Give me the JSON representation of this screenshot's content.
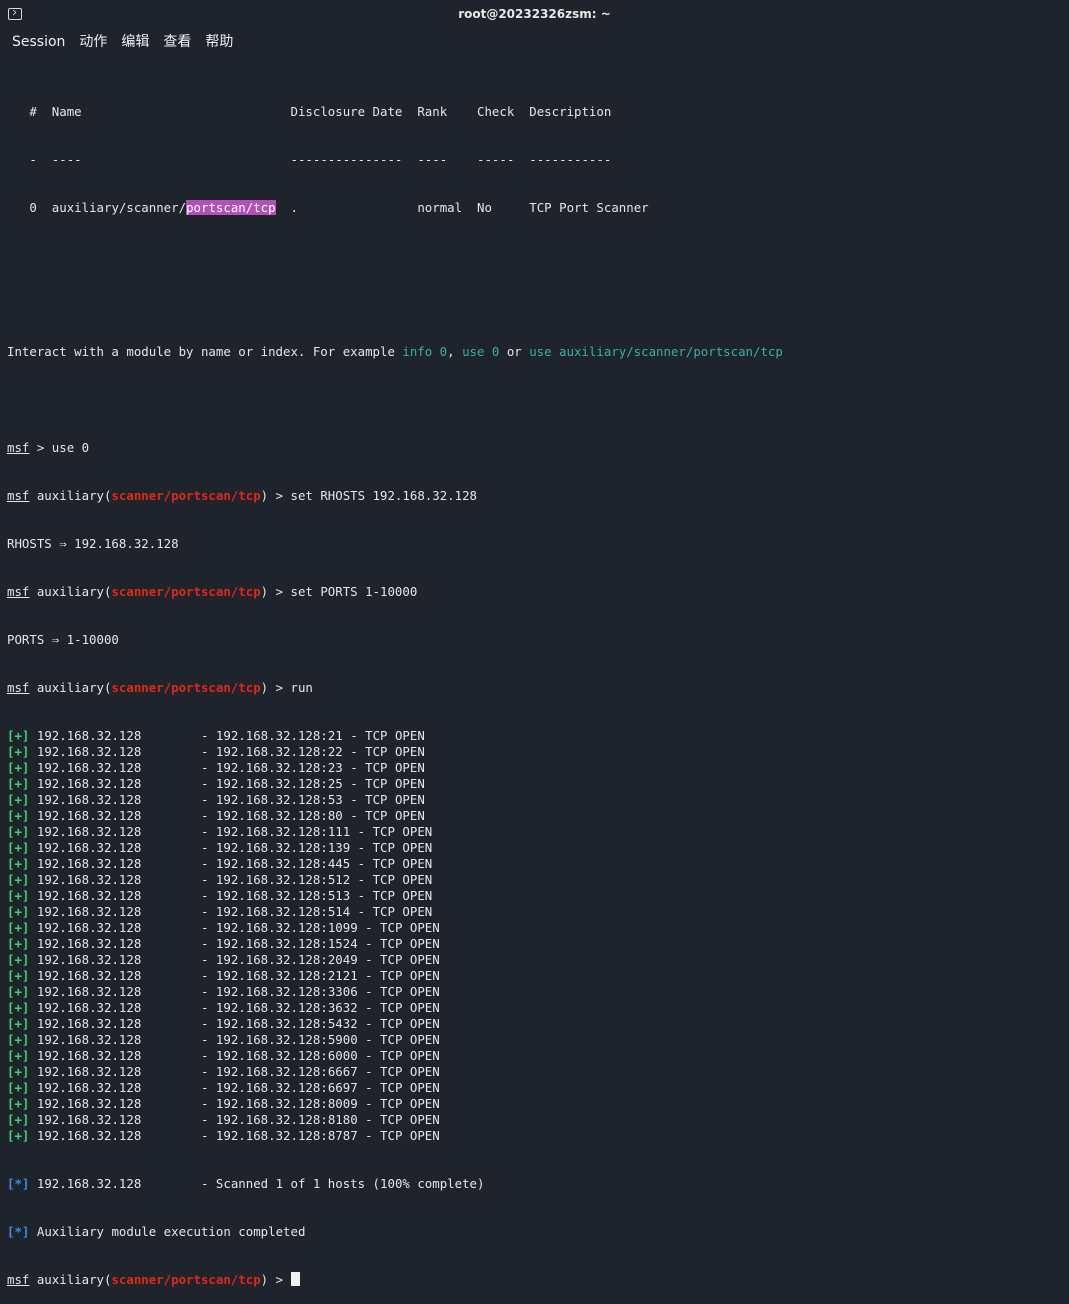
{
  "window": {
    "title": "root@20232326zsm: ~"
  },
  "menu": [
    "Session",
    "动作",
    "编辑",
    "查看",
    "帮助"
  ],
  "table": {
    "headers": [
      "#",
      "Name",
      "Disclosure Date",
      "Rank",
      "Check",
      "Description"
    ],
    "underlines": [
      "-",
      "----",
      "---------------",
      "----",
      "-----",
      "-----------"
    ],
    "row": {
      "num": "0",
      "name_prefix": "auxiliary/scanner/",
      "name_highlight": "portscan/tcp",
      "date": ".",
      "rank": "normal",
      "check": "No",
      "desc": "TCP Port Scanner"
    }
  },
  "interact": {
    "text1": "Interact with a module by name or index. For example ",
    "ex1": "info 0",
    "sep1": ", ",
    "ex2": "use 0",
    "sep2": " or ",
    "ex3": "use auxiliary/scanner/portscan/tcp"
  },
  "prompt": {
    "msf": "msf",
    "aux_open": " auxiliary(",
    "module": "scanner/portscan/tcp",
    "aux_close": ") > "
  },
  "commands": {
    "use": " > use 0",
    "set_rhosts": "set RHOSTS 192.168.32.128",
    "rhosts_result": "RHOSTS ⇒ 192.168.32.128",
    "set_ports": "set PORTS 1-10000",
    "ports_result": "PORTS ⇒ 1-10000",
    "run": "run"
  },
  "scan_host": "192.168.32.128",
  "open_ports": [
    "21",
    "22",
    "23",
    "25",
    "53",
    "80",
    "111",
    "139",
    "445",
    "512",
    "513",
    "514",
    "1099",
    "1524",
    "2049",
    "2121",
    "3306",
    "3632",
    "5432",
    "5900",
    "6000",
    "6667",
    "6697",
    "8009",
    "8180",
    "8787"
  ],
  "summary": {
    "plus_tag": "[+]",
    "info_tag": "[*]",
    "scanned": "- Scanned 1 of 1 hosts (100% complete)",
    "completed": "Auxiliary module execution completed"
  }
}
